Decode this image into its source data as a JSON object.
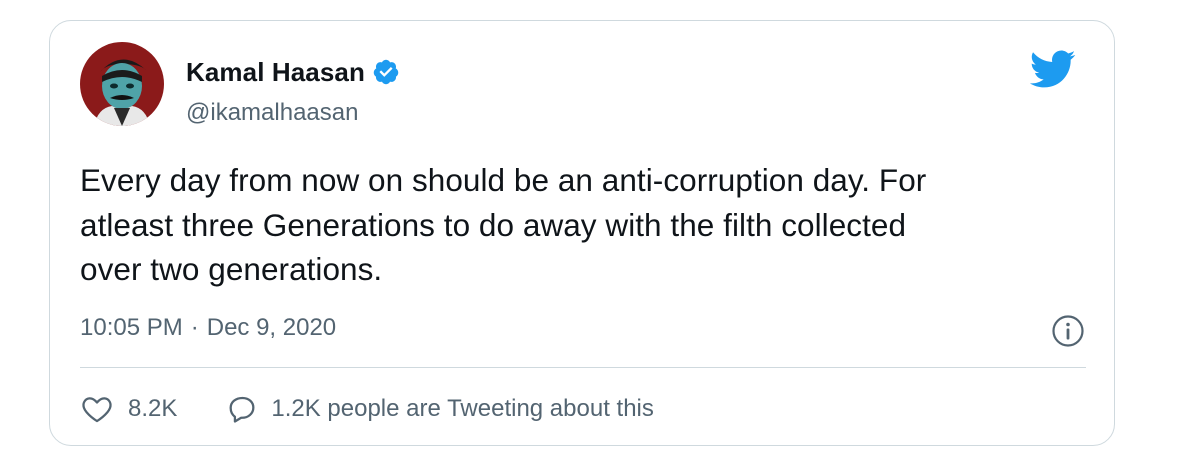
{
  "user": {
    "name": "Kamal Haasan",
    "handle": "@ikamalhaasan",
    "verified": true,
    "avatar_icon": "avatar-portrait"
  },
  "tweet": {
    "lines": [
      "Every day from now on should be an anti-corruption day. For",
      "atleast three Generations to do away with the filth collected",
      "over two generations."
    ],
    "time": "10:05 PM",
    "separator": "·",
    "date": "Dec 9, 2020"
  },
  "actions": {
    "like_count": "8.2K",
    "tweeting_text": "1.2K people are Tweeting about this"
  },
  "colors": {
    "twitter_blue": "#1d9bf0",
    "secondary_text": "#536471",
    "border": "#cfd9de",
    "avatar_bg": "#8b1a1a"
  },
  "icons": [
    "twitter-bird-icon",
    "verified-badge-icon",
    "info-icon",
    "heart-icon",
    "reply-bubble-icon"
  ]
}
